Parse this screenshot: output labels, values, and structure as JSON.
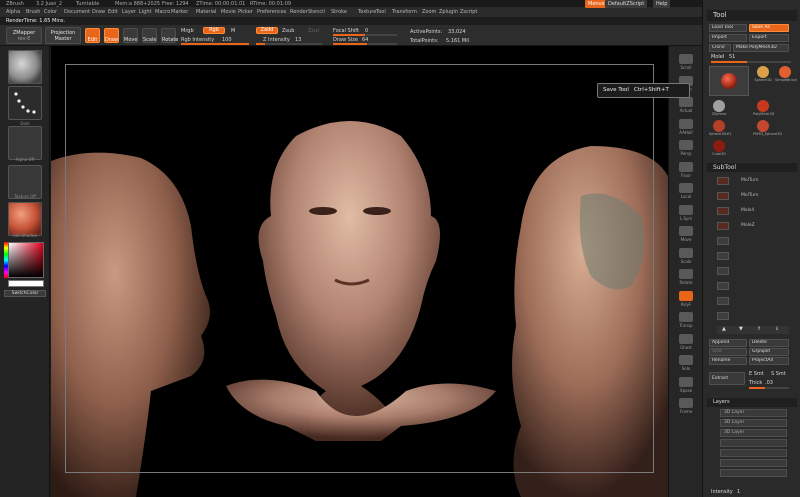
{
  "titlebar": {
    "app": "ZBrush",
    "doc": "3.2 Juan_2",
    "mode": "Turntable",
    "mem": "Mem:a 888+2025",
    "free": "Free: 1294",
    "ztime": "ZTime: 00:00:01.01",
    "rtime": "RTime: 00:01:09"
  },
  "top_buttons": {
    "menus": "Menus",
    "default_script": "DefaultZScript",
    "help": "Help"
  },
  "menu": [
    "Alpha",
    "Brush",
    "Color",
    "Document",
    "Draw",
    "Edit",
    "Layer",
    "Light",
    "Macro",
    "Marker",
    "Material",
    "Movie",
    "Picker",
    "Preferences",
    "Render",
    "Stencil",
    "Stroke",
    "Texture",
    "Tool",
    "Transform",
    "Zoom",
    "Zplugin",
    "Zscript"
  ],
  "render_time": "RenderTime: 1.65 Mins.",
  "toolbar": {
    "zmapper": "ZMapper",
    "zmapper_sub": "rev-E",
    "projection_master": "Projection",
    "projection_sub": "Master",
    "edit": "Edit",
    "draw": "Draw",
    "move": "Move",
    "scale": "Scale",
    "rotate": "Rotate",
    "mrgb": "Mrgb",
    "rgb": "Rgb",
    "m": "M",
    "rgb_intensity_label": "Rgb Intensity",
    "rgb_intensity": "100",
    "zadd": "Zadd",
    "zsub": "Zsub",
    "zcut": "Zcut",
    "z_intensity_label": "Z Intensity",
    "z_intensity": "13",
    "focal_shift_label": "Focal Shift",
    "focal_shift": "0",
    "draw_size_label": "Draw Size",
    "draw_size": "64",
    "active_points_label": "ActivePoints:",
    "active_points": "33,024",
    "total_points_label": "TotalPoints:",
    "total_points": "5.161 Mil"
  },
  "left_panel": {
    "brush_caption": "Standard",
    "stroke_caption": "Dots",
    "alpha_caption": "Alpha Off",
    "texture_caption": "Texture Off",
    "material_caption": "SkinShade4",
    "switch_color": "SwitchColor"
  },
  "right_strip": [
    "Scroll",
    "Zoom",
    "Actual",
    "AAHalf",
    "Persp",
    "Floor",
    "Local",
    "L.Sym",
    "Move",
    "Scale",
    "Rotate",
    "PolyF",
    "Transp",
    "Ghost",
    "Solo",
    "Xpose",
    "Frame"
  ],
  "tooltip": {
    "title": "Save Tool",
    "shortcut": "Ctrl+Shift+T"
  },
  "tool_palette": {
    "title": "Tool",
    "load_tool": "Load Tool",
    "save_as": "Save As",
    "import": "Import",
    "export": "Export",
    "clone": "Clone",
    "make_polymesh": "Make PolyMesh3D",
    "mask_label": "MoleI",
    "mask_value": "51",
    "tiles": [
      "Sphere3D",
      "SimpleBrush",
      "ZSphere",
      "PolyMesh3D",
      "Sphere3D#1",
      "PM3D_Sphere3D",
      "Cube3D"
    ],
    "subtool_title": "SubTool",
    "subtools": [
      "MolTurn",
      "MolTurn",
      "Mols4",
      "MoleZ",
      "",
      "",
      "",
      "",
      "",
      ""
    ],
    "append": "Append",
    "delete": "Delete",
    "split": "Split",
    "grp_split": "GrpSplit",
    "rename": "Rename",
    "project_all": "ProjectAll",
    "extract": "Extract",
    "e_smt": "E Smt",
    "s_smt": "S Smt",
    "thick_label": "Thick",
    "thick": ".03",
    "layers_title": "Layers",
    "layers": [
      "3D Layer",
      "3D Layer",
      "3D Layer",
      "",
      "",
      "",
      ""
    ],
    "intensity_label": "Intensity",
    "intensity": "1"
  },
  "colors": {
    "accent": "#e8651a",
    "panel": "#2a2a2a",
    "canvas": "#000000"
  }
}
